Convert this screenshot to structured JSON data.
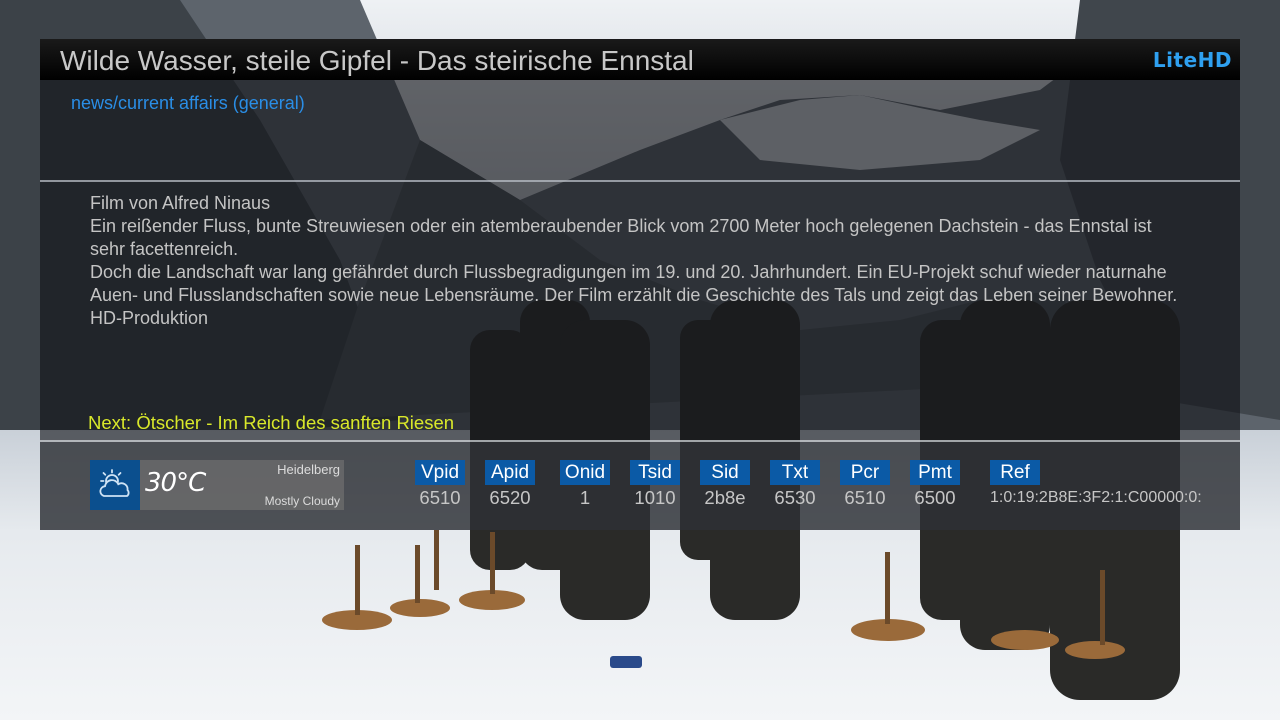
{
  "event": {
    "title": "Wilde Wasser, steile Gipfel - Das steirische Ennstal",
    "brand": "LiteHD",
    "genre": "news/current affairs (general)",
    "description": [
      "Film von Alfred Ninaus",
      "Ein reißender Fluss, bunte Streuwiesen oder ein atemberaubender Blick vom 2700 Meter hoch gelegenen Dachstein - das Ennstal ist sehr facettenreich.",
      "Doch die Landschaft war lang gefährdet durch Flussbegradigungen im 19. und 20. Jahrhundert. Ein EU-Projekt schuf wieder naturnahe Auen- und Flusslandschaften sowie neue Lebensräume. Der Film erzählt die Geschichte des Tals und zeigt das Leben seiner Bewohner.",
      "HD-Produktion"
    ],
    "next": "Next: Ötscher - Im Reich des sanften Riesen"
  },
  "weather": {
    "icon": "partly-cloudy-icon",
    "temperature": "30°C",
    "city": "Heidelberg",
    "condition": "Mostly Cloudy"
  },
  "pids": [
    {
      "label": "Vpid",
      "value": "6510"
    },
    {
      "label": "Apid",
      "value": "6520"
    },
    {
      "label": "Onid",
      "value": "1"
    },
    {
      "label": "Tsid",
      "value": "1010"
    },
    {
      "label": "Sid",
      "value": "2b8e"
    },
    {
      "label": "Txt",
      "value": "6530"
    },
    {
      "label": "Pcr",
      "value": "6510"
    },
    {
      "label": "Pmt",
      "value": "6500"
    },
    {
      "label": "Ref",
      "value": "1:0:19:2B8E:3F2:1:C00000:0:"
    }
  ],
  "colors": {
    "accent_blue": "#0b5aa6",
    "brand_blue": "#2fa0f0",
    "genre_blue": "#2a8ee6",
    "next_yellow": "#d9e82a"
  }
}
